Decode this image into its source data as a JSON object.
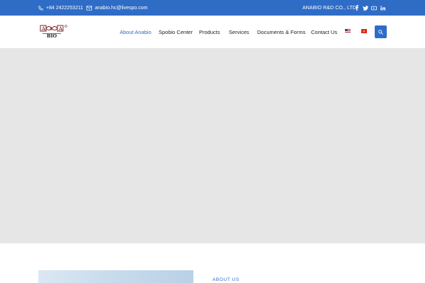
{
  "topbar": {
    "phone": "+84 2422253211",
    "email": "anabio.hc@livespo.com",
    "company": "ANABIO R&D CO., LTD",
    "social_icons": [
      "facebook-icon",
      "twitter-icon",
      "youtube-icon",
      "linkedin-icon"
    ],
    "background": "#2f6cc6"
  },
  "header": {
    "logo_text": "A & A",
    "logo_subtext": "BIO",
    "nav": [
      {
        "label": "About Anabio",
        "active": true
      },
      {
        "label": "Spobio Center",
        "active": false
      },
      {
        "label": "Products",
        "active": false
      },
      {
        "label": "Services",
        "active": false
      },
      {
        "label": "Documents & Forms",
        "active": false
      },
      {
        "label": "Contact Us",
        "active": false
      }
    ],
    "languages": [
      "us-flag-icon",
      "vn-flag-icon"
    ],
    "accent": "#2f6cc6"
  },
  "about": {
    "label": "ABOUT US"
  }
}
